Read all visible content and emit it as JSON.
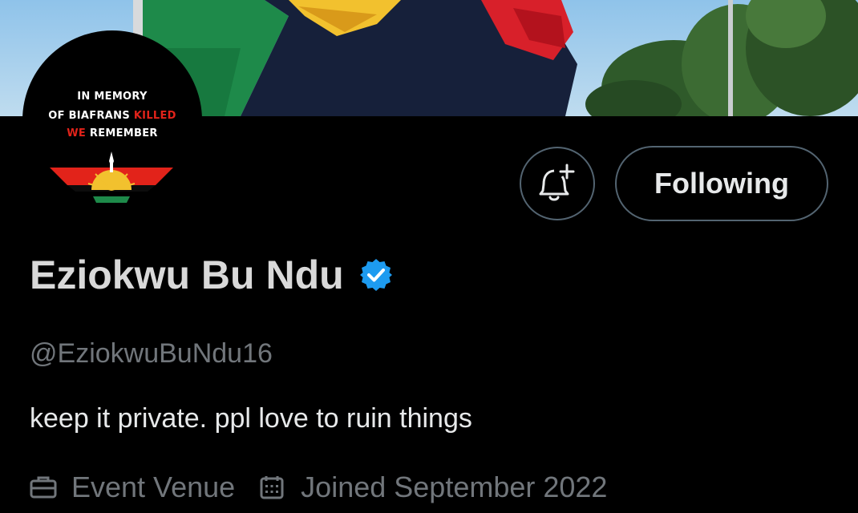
{
  "banner": {
    "description_icon": "flag-banner-image"
  },
  "avatar": {
    "line1": "IN MEMORY",
    "line2_white": "OF BIAFRANS ",
    "line2_red": "KILLED",
    "line3_red": "WE",
    "line3_white": " REMEMBER",
    "emblem_icon": "rising-sun-emblem"
  },
  "actions": {
    "notify_icon": "bell-plus-icon",
    "following_label": "Following"
  },
  "profile": {
    "display_name": "Eziokwu Bu Ndu",
    "verified_icon": "verified-badge-icon",
    "handle": "@EziokwuBuNdu16",
    "bio": "keep it private. ppl love to ruin things",
    "location_icon": "briefcase-icon",
    "location": "Event Venue",
    "joined_icon": "calendar-icon",
    "joined": "Joined September 2022"
  },
  "colors": {
    "background": "#000000",
    "verified": "#1d9bf0",
    "muted_text": "#71767b",
    "border": "#536471",
    "flag_green": "#1e8a4a",
    "flag_red": "#e2231a",
    "flag_black": "#0c1020",
    "sky": "#a9cde8"
  }
}
